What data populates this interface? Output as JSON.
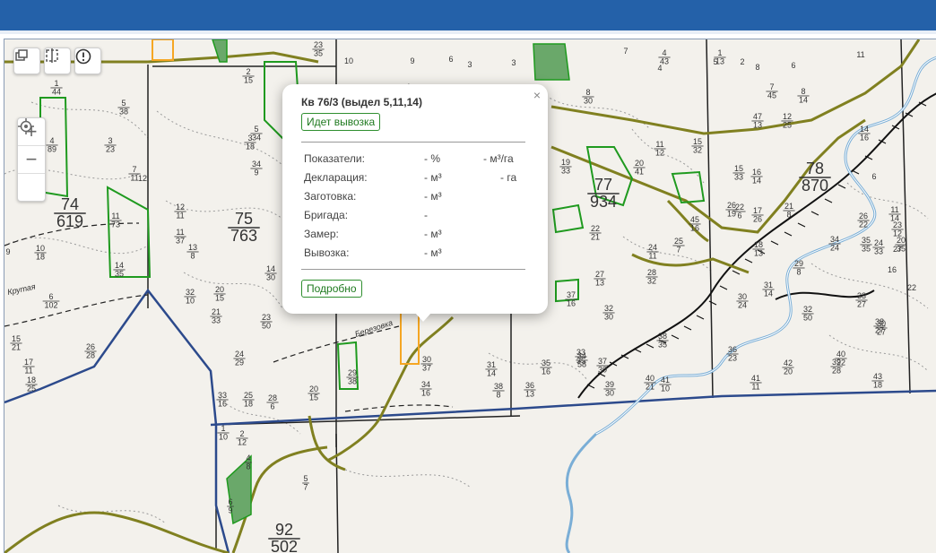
{
  "header": {
    "bar_color": "#2461a9"
  },
  "controls": {
    "layers_icon": "layers-icon",
    "split_icon": "split-view-icon",
    "info_icon": "alert-circle-icon",
    "zoom_in": "+",
    "zoom_out": "−",
    "locate_icon": "locate-icon"
  },
  "popup": {
    "close": "×",
    "title": "Кв 76/3 (выдел 5,11,14)",
    "status_button": "Идет вывозка",
    "rows": [
      {
        "label": "Показатели:",
        "v1": "- %",
        "v2": "- м³/га"
      },
      {
        "label": "Декларация:",
        "v1": "- м³",
        "v2": "- га"
      },
      {
        "label": "Заготовка:",
        "v1": "- м³",
        "v2": ""
      },
      {
        "label": "Бригада:",
        "v1": "-",
        "v2": ""
      },
      {
        "label": "Замер:",
        "v1": "- м³",
        "v2": ""
      },
      {
        "label": "Вывозка:",
        "v1": "- м³",
        "v2": ""
      }
    ],
    "details_button": "Подробно"
  },
  "map": {
    "quarters": [
      {
        "top": "74",
        "bottom": "619"
      },
      {
        "top": "75",
        "bottom": "763"
      },
      {
        "top": "77",
        "bottom": "934"
      },
      {
        "top": "78",
        "bottom": "870"
      },
      {
        "top": "92",
        "bottom": "502"
      }
    ],
    "road_labels": [
      "Крутая",
      "Березовка"
    ],
    "colors": {
      "boundary": "#2c4a8c",
      "road": "#808020",
      "allotment": "#1f9a1f",
      "highlight": "#f5a623",
      "river": "#7aaed6"
    },
    "plot_labels": [
      {
        "t": "1",
        "b": "44"
      },
      {
        "t": "5",
        "b": "38"
      },
      {
        "t": "3",
        "b": "23"
      },
      {
        "t": "7",
        "b": "11"
      },
      {
        "t": "12",
        "b": ""
      },
      {
        "t": "4",
        "b": "89"
      },
      {
        "t": "11",
        "b": "73"
      },
      {
        "t": "14",
        "b": "35"
      },
      {
        "t": "12",
        "b": "11"
      },
      {
        "t": "11",
        "b": "37"
      },
      {
        "t": "13",
        "b": "8"
      },
      {
        "t": "9",
        "b": ""
      },
      {
        "t": "10",
        "b": "18"
      },
      {
        "t": "6",
        "b": "102"
      },
      {
        "t": "32",
        "b": "10"
      },
      {
        "t": "20",
        "b": "15"
      },
      {
        "t": "21",
        "b": "33"
      },
      {
        "t": "14",
        "b": "30"
      },
      {
        "t": "23",
        "b": "50"
      },
      {
        "t": "24",
        "b": "29"
      },
      {
        "t": "15",
        "b": "21"
      },
      {
        "t": "17",
        "b": "11"
      },
      {
        "t": "18",
        "b": "25"
      },
      {
        "t": "26",
        "b": "28"
      },
      {
        "t": "33",
        "b": "16"
      },
      {
        "t": "25",
        "b": "18"
      },
      {
        "t": "28",
        "b": "6"
      },
      {
        "t": "20",
        "b": "15"
      },
      {
        "t": "29",
        "b": "38"
      },
      {
        "t": "1",
        "b": "10"
      },
      {
        "t": "2",
        "b": "12"
      },
      {
        "t": "4",
        "b": "8"
      },
      {
        "t": "5",
        "b": "7"
      },
      {
        "t": "6",
        "b": "9"
      },
      {
        "t": "30",
        "b": "37"
      },
      {
        "t": "34",
        "b": "16"
      },
      {
        "t": "31",
        "b": "14"
      },
      {
        "t": "35",
        "b": "16"
      },
      {
        "t": "36",
        "b": "13"
      },
      {
        "t": "33",
        "b": "35"
      },
      {
        "t": "32",
        "b": "30"
      },
      {
        "t": "37",
        "b": "16"
      },
      {
        "t": "38",
        "b": "8"
      },
      {
        "t": "34",
        "b": "58"
      },
      {
        "t": "37",
        "b": "30"
      },
      {
        "t": "38",
        "b": "35"
      },
      {
        "t": "36",
        "b": "23"
      },
      {
        "t": "39",
        "b": "30"
      },
      {
        "t": "40",
        "b": "21"
      },
      {
        "t": "41",
        "b": "10"
      },
      {
        "t": "41",
        "b": "11"
      },
      {
        "t": "42",
        "b": "20"
      },
      {
        "t": "43",
        "b": "18"
      },
      {
        "t": "40",
        "b": "22"
      },
      {
        "t": "39",
        "b": "28"
      },
      {
        "t": "38",
        "b": "27"
      },
      {
        "t": "32",
        "b": "50"
      },
      {
        "t": "30",
        "b": "27"
      },
      {
        "t": "33",
        "b": "27"
      },
      {
        "t": "34",
        "b": "24"
      },
      {
        "t": "35",
        "b": "35"
      },
      {
        "t": "22",
        "b": "6"
      },
      {
        "t": "28",
        "b": "32"
      },
      {
        "t": "27",
        "b": "13"
      },
      {
        "t": "22",
        "b": "21"
      },
      {
        "t": "24",
        "b": "11"
      },
      {
        "t": "25",
        "b": "7"
      },
      {
        "t": "45",
        "b": "16"
      },
      {
        "t": "26",
        "b": "19"
      },
      {
        "t": "17",
        "b": "26"
      },
      {
        "t": "18",
        "b": "13"
      },
      {
        "t": "21",
        "b": "8"
      },
      {
        "t": "31",
        "b": "14"
      },
      {
        "t": "30",
        "b": "24"
      },
      {
        "t": "29",
        "b": "8"
      },
      {
        "t": "15",
        "b": "33"
      },
      {
        "t": "16",
        "b": "14"
      },
      {
        "t": "20",
        "b": "41"
      },
      {
        "t": "19",
        "b": "33"
      },
      {
        "t": "13",
        "b": "26"
      },
      {
        "t": "11",
        "b": "12"
      },
      {
        "t": "15",
        "b": "32"
      },
      {
        "t": "47",
        "b": "13"
      },
      {
        "t": "12",
        "b": "25"
      },
      {
        "t": "8",
        "b": "14"
      },
      {
        "t": "7",
        "b": "45"
      },
      {
        "t": "4",
        "b": "43"
      },
      {
        "t": "1",
        "b": "13"
      },
      {
        "t": "2",
        "b": "15"
      },
      {
        "t": "3",
        "b": "18"
      },
      {
        "t": "34",
        "b": "9"
      },
      {
        "t": "5",
        "b": "34"
      },
      {
        "t": "8",
        "b": "30"
      },
      {
        "t": "14",
        "b": "16"
      },
      {
        "t": "11",
        "b": "14"
      },
      {
        "t": "20",
        "b": "35"
      },
      {
        "t": "23",
        "b": "12"
      },
      {
        "t": "26",
        "b": "22"
      },
      {
        "t": "24",
        "b": "33"
      },
      {
        "t": "27",
        "b": ""
      },
      {
        "t": "23",
        "b": "35"
      },
      {
        "t": "4",
        "b": "9"
      }
    ],
    "scattered_numbers": [
      "10",
      "9",
      "6",
      "3",
      "7",
      "4",
      "5",
      "2",
      "8",
      "6",
      "11",
      "3",
      "7",
      "9",
      "8",
      "4",
      "2",
      "5",
      "16",
      "22",
      "6"
    ]
  }
}
